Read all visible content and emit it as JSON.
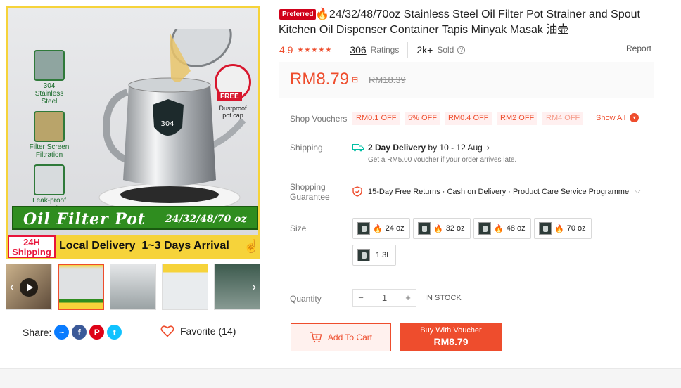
{
  "gallery": {
    "features": [
      "304\nStainless Steel",
      "Filter Screen\nFiltration",
      "Leak-proof\nspout"
    ],
    "banner_title": "Oil Filter Pot",
    "banner_sizes": "24/32/48/70 oz",
    "badge_24h": "24H\nShipping",
    "delivery_text": "Local Delivery  1~3 Days Arrival",
    "free_tag": "FREE",
    "free_caption": "Dustproof\npot cap",
    "kettle_badge": "304",
    "thumbnail_count": 5
  },
  "share": {
    "label": "Share:"
  },
  "favorite": {
    "label": "Favorite (14)"
  },
  "product": {
    "preferred_badge": "Preferred",
    "title": "24/32/48/70oz Stainless Steel Oil Filter Pot Strainer and Spout Kitchen Oil Dispenser Container Tapis Minyak Masak 油壶",
    "rating": "4.9",
    "ratings_count": "306",
    "ratings_label": "Ratings",
    "sold_count": "2k+",
    "sold_label": "Sold",
    "report": "Report",
    "price": "RM8.79",
    "original_price": "RM18.39"
  },
  "vouchers": {
    "label": "Shop Vouchers",
    "items": [
      "RM0.1 OFF",
      "5% OFF",
      "RM0.4 OFF",
      "RM2 OFF",
      "RM4 OFF"
    ],
    "show_all": "Show All"
  },
  "shipping": {
    "label": "Shipping",
    "delivery_bold": "2 Day Delivery",
    "delivery_rest": " by 10 - 12 Aug",
    "note": "Get a RM5.00 voucher if your order arrives late."
  },
  "guarantee": {
    "label": "Shopping\nGuarantee",
    "text": "15-Day Free Returns · Cash on Delivery · Product Care Service Programme"
  },
  "sizes": {
    "label": "Size",
    "options": [
      "24 oz",
      "32 oz",
      "48 oz",
      "70 oz",
      "1.3L"
    ]
  },
  "quantity": {
    "label": "Quantity",
    "value": "1",
    "minus": "−",
    "plus": "+",
    "stock": "IN STOCK"
  },
  "actions": {
    "add_to_cart": "Add To Cart",
    "buy_line1": "Buy With Voucher",
    "buy_line2": "RM8.79"
  }
}
